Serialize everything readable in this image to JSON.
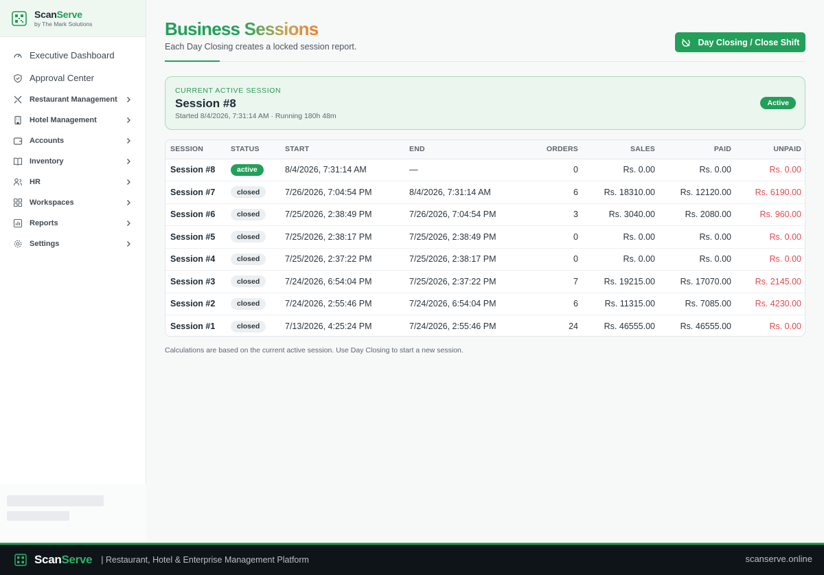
{
  "brand": {
    "name_a": "Scan",
    "name_b": "Serve",
    "sub": "by The Mark Solutions"
  },
  "sidebar": {
    "items": [
      {
        "label": "Executive Dashboard",
        "icon": "gauge-icon",
        "top": true
      },
      {
        "label": "Approval Center",
        "icon": "shield-check-icon",
        "top": true
      },
      {
        "label": "Restaurant Management",
        "icon": "utensils-icon",
        "chevron": true
      },
      {
        "label": "Hotel Management",
        "icon": "building-icon",
        "chevron": true
      },
      {
        "label": "Accounts",
        "icon": "wallet-icon",
        "chevron": true
      },
      {
        "label": "Inventory",
        "icon": "book-icon",
        "chevron": true
      },
      {
        "label": "HR",
        "icon": "users-icon",
        "chevron": true
      },
      {
        "label": "Workspaces",
        "icon": "grid-icon",
        "chevron": true
      },
      {
        "label": "Reports",
        "icon": "chart-icon",
        "chevron": true
      },
      {
        "label": "Settings",
        "icon": "gear-icon",
        "chevron": true
      }
    ]
  },
  "header": {
    "title_a": "Business",
    "title_b": "Sessions",
    "subtitle": "Each Day Closing creates a locked session report.",
    "close_button": "Day Closing / Close Shift"
  },
  "active_session": {
    "kicker": "CURRENT ACTIVE SESSION",
    "title": "Session #8",
    "meta": "Started 8/4/2026, 7:31:14 AM · Running 180h 48m",
    "badge": "Active"
  },
  "table": {
    "columns": [
      "SESSION",
      "STATUS",
      "START",
      "END",
      "ORDERS",
      "SALES",
      "PAID",
      "UNPAID"
    ],
    "rows": [
      {
        "session": "Session #8",
        "status": "active",
        "start": "8/4/2026, 7:31:14 AM",
        "end": "—",
        "orders": "0",
        "sales": "Rs. 0.00",
        "paid": "Rs. 0.00",
        "unpaid": "Rs. 0.00"
      },
      {
        "session": "Session #7",
        "status": "closed",
        "start": "7/26/2026, 7:04:54 PM",
        "end": "8/4/2026, 7:31:14 AM",
        "orders": "6",
        "sales": "Rs. 18310.00",
        "paid": "Rs. 12120.00",
        "unpaid": "Rs. 6190.00"
      },
      {
        "session": "Session #6",
        "status": "closed",
        "start": "7/25/2026, 2:38:49 PM",
        "end": "7/26/2026, 7:04:54 PM",
        "orders": "3",
        "sales": "Rs. 3040.00",
        "paid": "Rs. 2080.00",
        "unpaid": "Rs. 960.00"
      },
      {
        "session": "Session #5",
        "status": "closed",
        "start": "7/25/2026, 2:38:17 PM",
        "end": "7/25/2026, 2:38:49 PM",
        "orders": "0",
        "sales": "Rs. 0.00",
        "paid": "Rs. 0.00",
        "unpaid": "Rs. 0.00"
      },
      {
        "session": "Session #4",
        "status": "closed",
        "start": "7/25/2026, 2:37:22 PM",
        "end": "7/25/2026, 2:38:17 PM",
        "orders": "0",
        "sales": "Rs. 0.00",
        "paid": "Rs. 0.00",
        "unpaid": "Rs. 0.00"
      },
      {
        "session": "Session #3",
        "status": "closed",
        "start": "7/24/2026, 6:54:04 PM",
        "end": "7/25/2026, 2:37:22 PM",
        "orders": "7",
        "sales": "Rs. 19215.00",
        "paid": "Rs. 17070.00",
        "unpaid": "Rs. 2145.00"
      },
      {
        "session": "Session #2",
        "status": "closed",
        "start": "7/24/2026, 2:55:46 PM",
        "end": "7/24/2026, 6:54:04 PM",
        "orders": "6",
        "sales": "Rs. 11315.00",
        "paid": "Rs. 7085.00",
        "unpaid": "Rs. 4230.00"
      },
      {
        "session": "Session #1",
        "status": "closed",
        "start": "7/13/2026, 4:25:24 PM",
        "end": "7/24/2026, 2:55:46 PM",
        "orders": "24",
        "sales": "Rs. 46555.00",
        "paid": "Rs. 46555.00",
        "unpaid": "Rs. 0.00"
      }
    ]
  },
  "footnote": "Calculations are based on the current active session. Use Day Closing to start a new session.",
  "footer": {
    "brand_a": "Scan",
    "brand_b": "Serve",
    "tagline": "| Restaurant, Hotel & Enterprise Management Platform",
    "domain": "scanserve.online"
  },
  "colors": {
    "accent": "#22a05a",
    "unpaid": "#e5484d",
    "footer_bg": "#0f1419"
  }
}
